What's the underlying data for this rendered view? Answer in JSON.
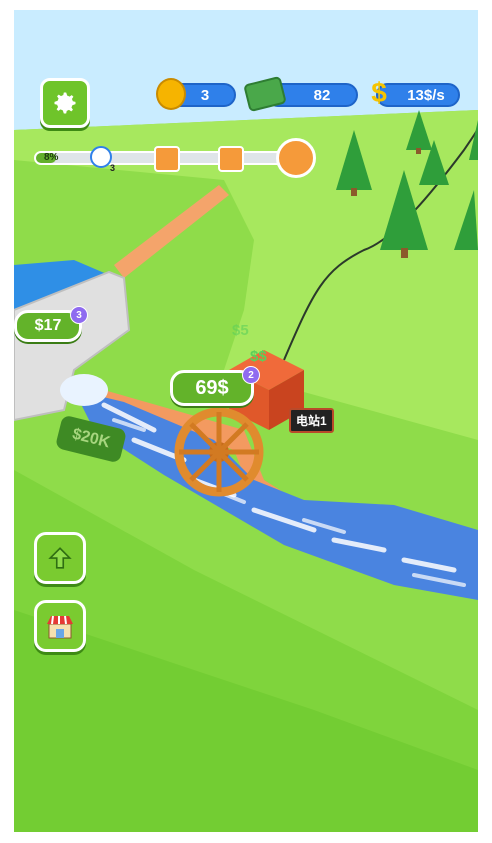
{
  "hud": {
    "coins": "3",
    "cash": "82",
    "income": "13$/s"
  },
  "progress": {
    "percent_label": "8%",
    "fill": 0.08,
    "timer_badge": "3"
  },
  "scene": {
    "dam_price": "$17",
    "dam_badge": "3",
    "wheel_price": "69$",
    "wheel_badge": "2",
    "ground_price": "$20K",
    "station_sign": "电站1",
    "float_small": "$5",
    "float_cash": "$$"
  },
  "icons": {
    "settings": "gear-icon",
    "coin": "coin-icon",
    "cash": "cash-stack-icon",
    "income": "income-arrow-icon",
    "timer": "stopwatch-icon",
    "gift": "gift-icon",
    "upgrade": "up-arrow-icon",
    "shop": "shop-icon"
  },
  "colors": {
    "grass": "#8fdc4a",
    "water": "#4a84e0",
    "button_green": "#6fc42a",
    "pill_blue": "#2f80ea"
  }
}
